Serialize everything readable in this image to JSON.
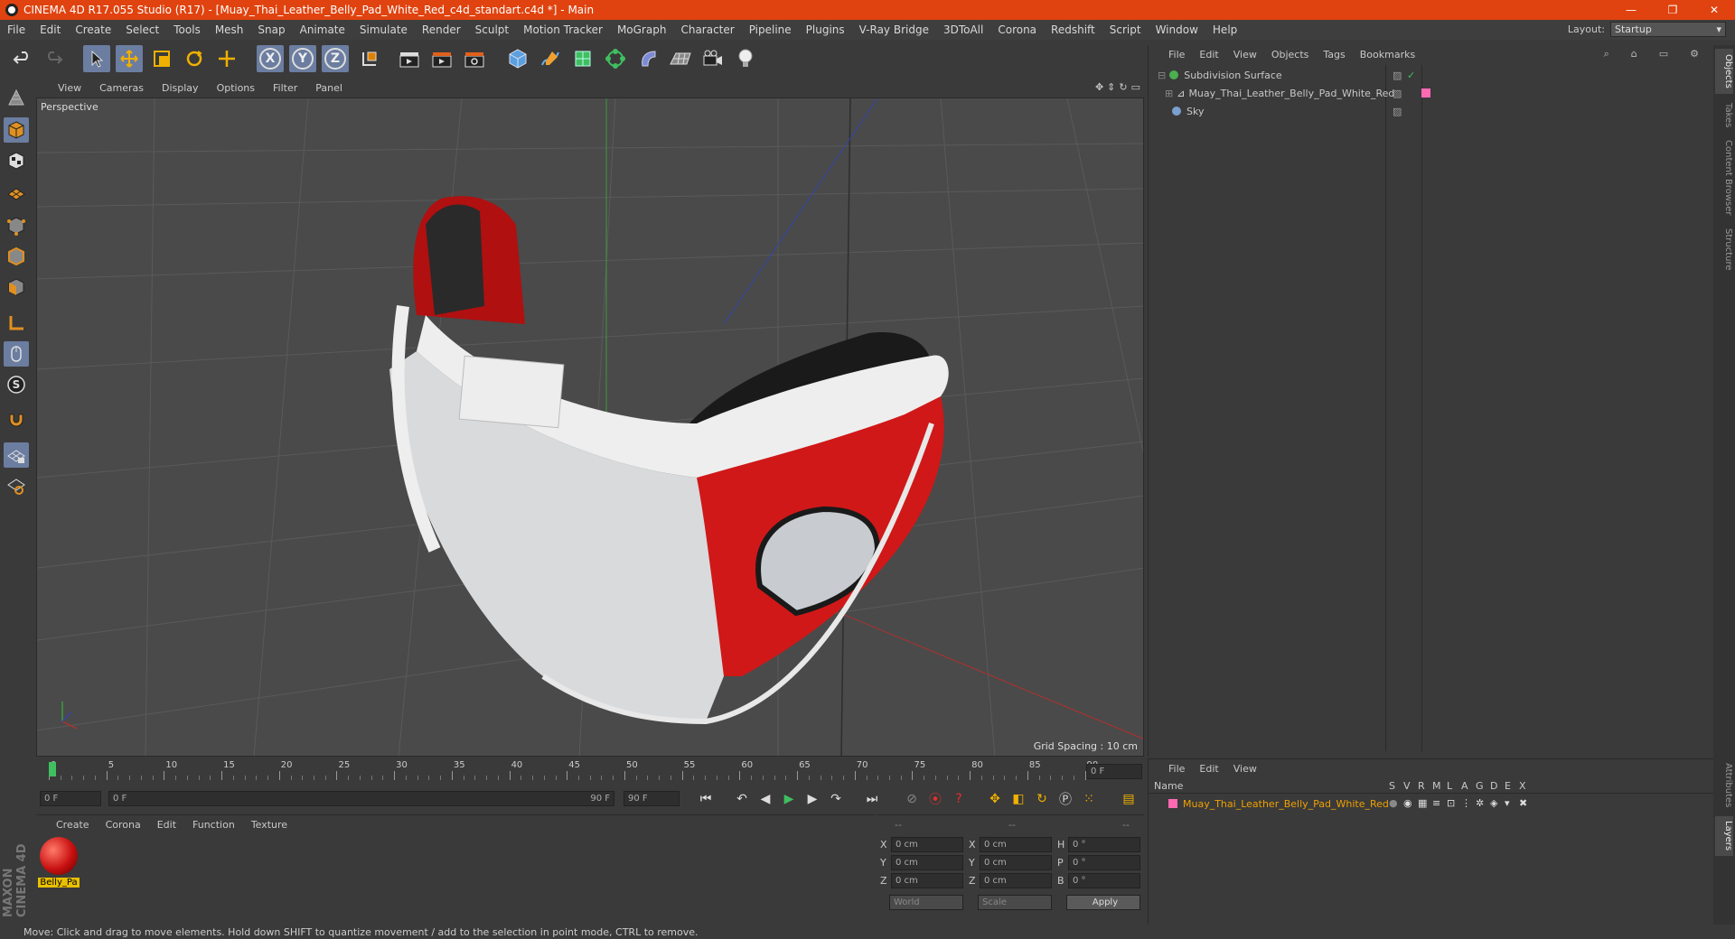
{
  "window": {
    "title": "CINEMA 4D R17.055 Studio (R17) - [Muay_Thai_Leather_Belly_Pad_White_Red_c4d_standart.c4d *] - Main",
    "controls": [
      "—",
      "❐",
      "✕"
    ]
  },
  "menu": {
    "items": [
      "File",
      "Edit",
      "Create",
      "Select",
      "Tools",
      "Mesh",
      "Snap",
      "Animate",
      "Simulate",
      "Render",
      "Sculpt",
      "Motion Tracker",
      "MoGraph",
      "Character",
      "Pipeline",
      "Plugins",
      "V-Ray Bridge",
      "3DToAll",
      "Corona",
      "Redshift",
      "Script",
      "Window",
      "Help"
    ],
    "layout_label": "Layout:",
    "layout_value": "Startup"
  },
  "toolbar": {
    "axes": [
      "X",
      "Y",
      "Z"
    ]
  },
  "viewport": {
    "menu": [
      "View",
      "Cameras",
      "Display",
      "Options",
      "Filter",
      "Panel"
    ],
    "camera_label": "Perspective",
    "grid_spacing": "Grid Spacing : 10 cm"
  },
  "timeline": {
    "ticks": [
      "0",
      "5",
      "10",
      "15",
      "20",
      "25",
      "30",
      "35",
      "40",
      "45",
      "50",
      "55",
      "60",
      "65",
      "70",
      "75",
      "80",
      "85",
      "90"
    ],
    "current_frame": "0 F",
    "start_field": "0 F",
    "range_start": "0 F",
    "range_end": "90 F",
    "end_field": "90 F"
  },
  "material_manager": {
    "menu": [
      "Create",
      "Corona",
      "Edit",
      "Function",
      "Texture"
    ],
    "materials": [
      {
        "name": "Belly_Pa"
      }
    ]
  },
  "coordinates": {
    "headers": [
      "--",
      "--",
      "--"
    ],
    "rows": [
      {
        "a": "X",
        "pos": "0 cm",
        "b": "X",
        "size": "0 cm",
        "c": "H",
        "rot": "0 °"
      },
      {
        "a": "Y",
        "pos": "0 cm",
        "b": "Y",
        "size": "0 cm",
        "c": "P",
        "rot": "0 °"
      },
      {
        "a": "Z",
        "pos": "0 cm",
        "b": "Z",
        "size": "0 cm",
        "c": "B",
        "rot": "0 °"
      }
    ],
    "mode_world": "World",
    "mode_scale": "Scale",
    "apply": "Apply"
  },
  "object_manager": {
    "menu": [
      "File",
      "Edit",
      "View",
      "Objects",
      "Tags",
      "Bookmarks"
    ],
    "objects": [
      {
        "name": "Subdivision Surface",
        "color": "#4caf50"
      },
      {
        "name": "Muay_Thai_Leather_Belly_Pad_White_Red",
        "color": "#ff69b4"
      },
      {
        "name": "Sky",
        "color": "#7aa0d0"
      }
    ]
  },
  "layer_manager": {
    "menu": [
      "File",
      "Edit",
      "View"
    ],
    "columns": [
      "Name",
      "S",
      "V",
      "R",
      "M",
      "L",
      "A",
      "G",
      "D",
      "E",
      "X"
    ],
    "layers": [
      {
        "name": "Muay_Thai_Leather_Belly_Pad_White_Red",
        "color": "#ff69b4"
      }
    ]
  },
  "side_tabs": [
    "Objects",
    "Takes",
    "Content Browser",
    "Structure",
    "Attributes",
    "Layers"
  ],
  "branding": "MAXON CINEMA 4D",
  "status": "Move: Click and drag to move elements. Hold down SHIFT to quantize movement / add to the selection in point mode, CTRL to remove."
}
